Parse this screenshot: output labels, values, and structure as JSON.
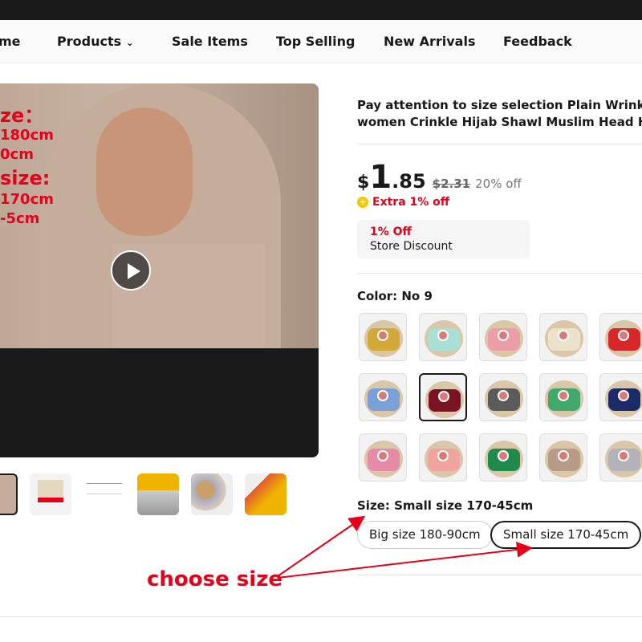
{
  "nav": {
    "items": [
      "me",
      "Products",
      "Sale Items",
      "Top Selling",
      "New Arrivals",
      "Feedback"
    ]
  },
  "hero": {
    "overlay_lines": [
      "ze：",
      "180cm",
      "0cm",
      "size:",
      "170cm",
      "-5cm"
    ],
    "play_icon": "play-icon"
  },
  "product": {
    "title_line1": "Pay attention to size selection Plain Wrinkle W",
    "title_line2": "women Crinkle Hijab Shawl Muslim Head Hija",
    "currency": "$",
    "price_int": "1",
    "price_dec": ".85",
    "old_price": "$2.31",
    "discount": "20% off",
    "extra": "Extra 1% off",
    "store_discount": {
      "amount": "1% Off",
      "label": "Store Discount"
    },
    "color_label": "Color: No 9",
    "swatches": [
      "#d2a838",
      "#a9dfd4",
      "#ec9ea8",
      "#ece2cc",
      "#d62828",
      "#7aa0d8",
      "#7a1424",
      "#5b5b5b",
      "#3fa86a",
      "#1c2a6a",
      "#e68aa8",
      "#f0a4a0",
      "#1f8a4c",
      "#b79b86",
      "#b2b2b8"
    ],
    "selected_swatch": 6,
    "size_label": "Size: Small size 170-45cm",
    "sizes": [
      "Big size 180-90cm",
      "Small size 170-45cm"
    ],
    "selected_size": 1
  },
  "annotation": {
    "text": "choose size",
    "color": "#e6001a"
  },
  "colors": {
    "accent": "#e6001a",
    "topbar": "#191919"
  }
}
